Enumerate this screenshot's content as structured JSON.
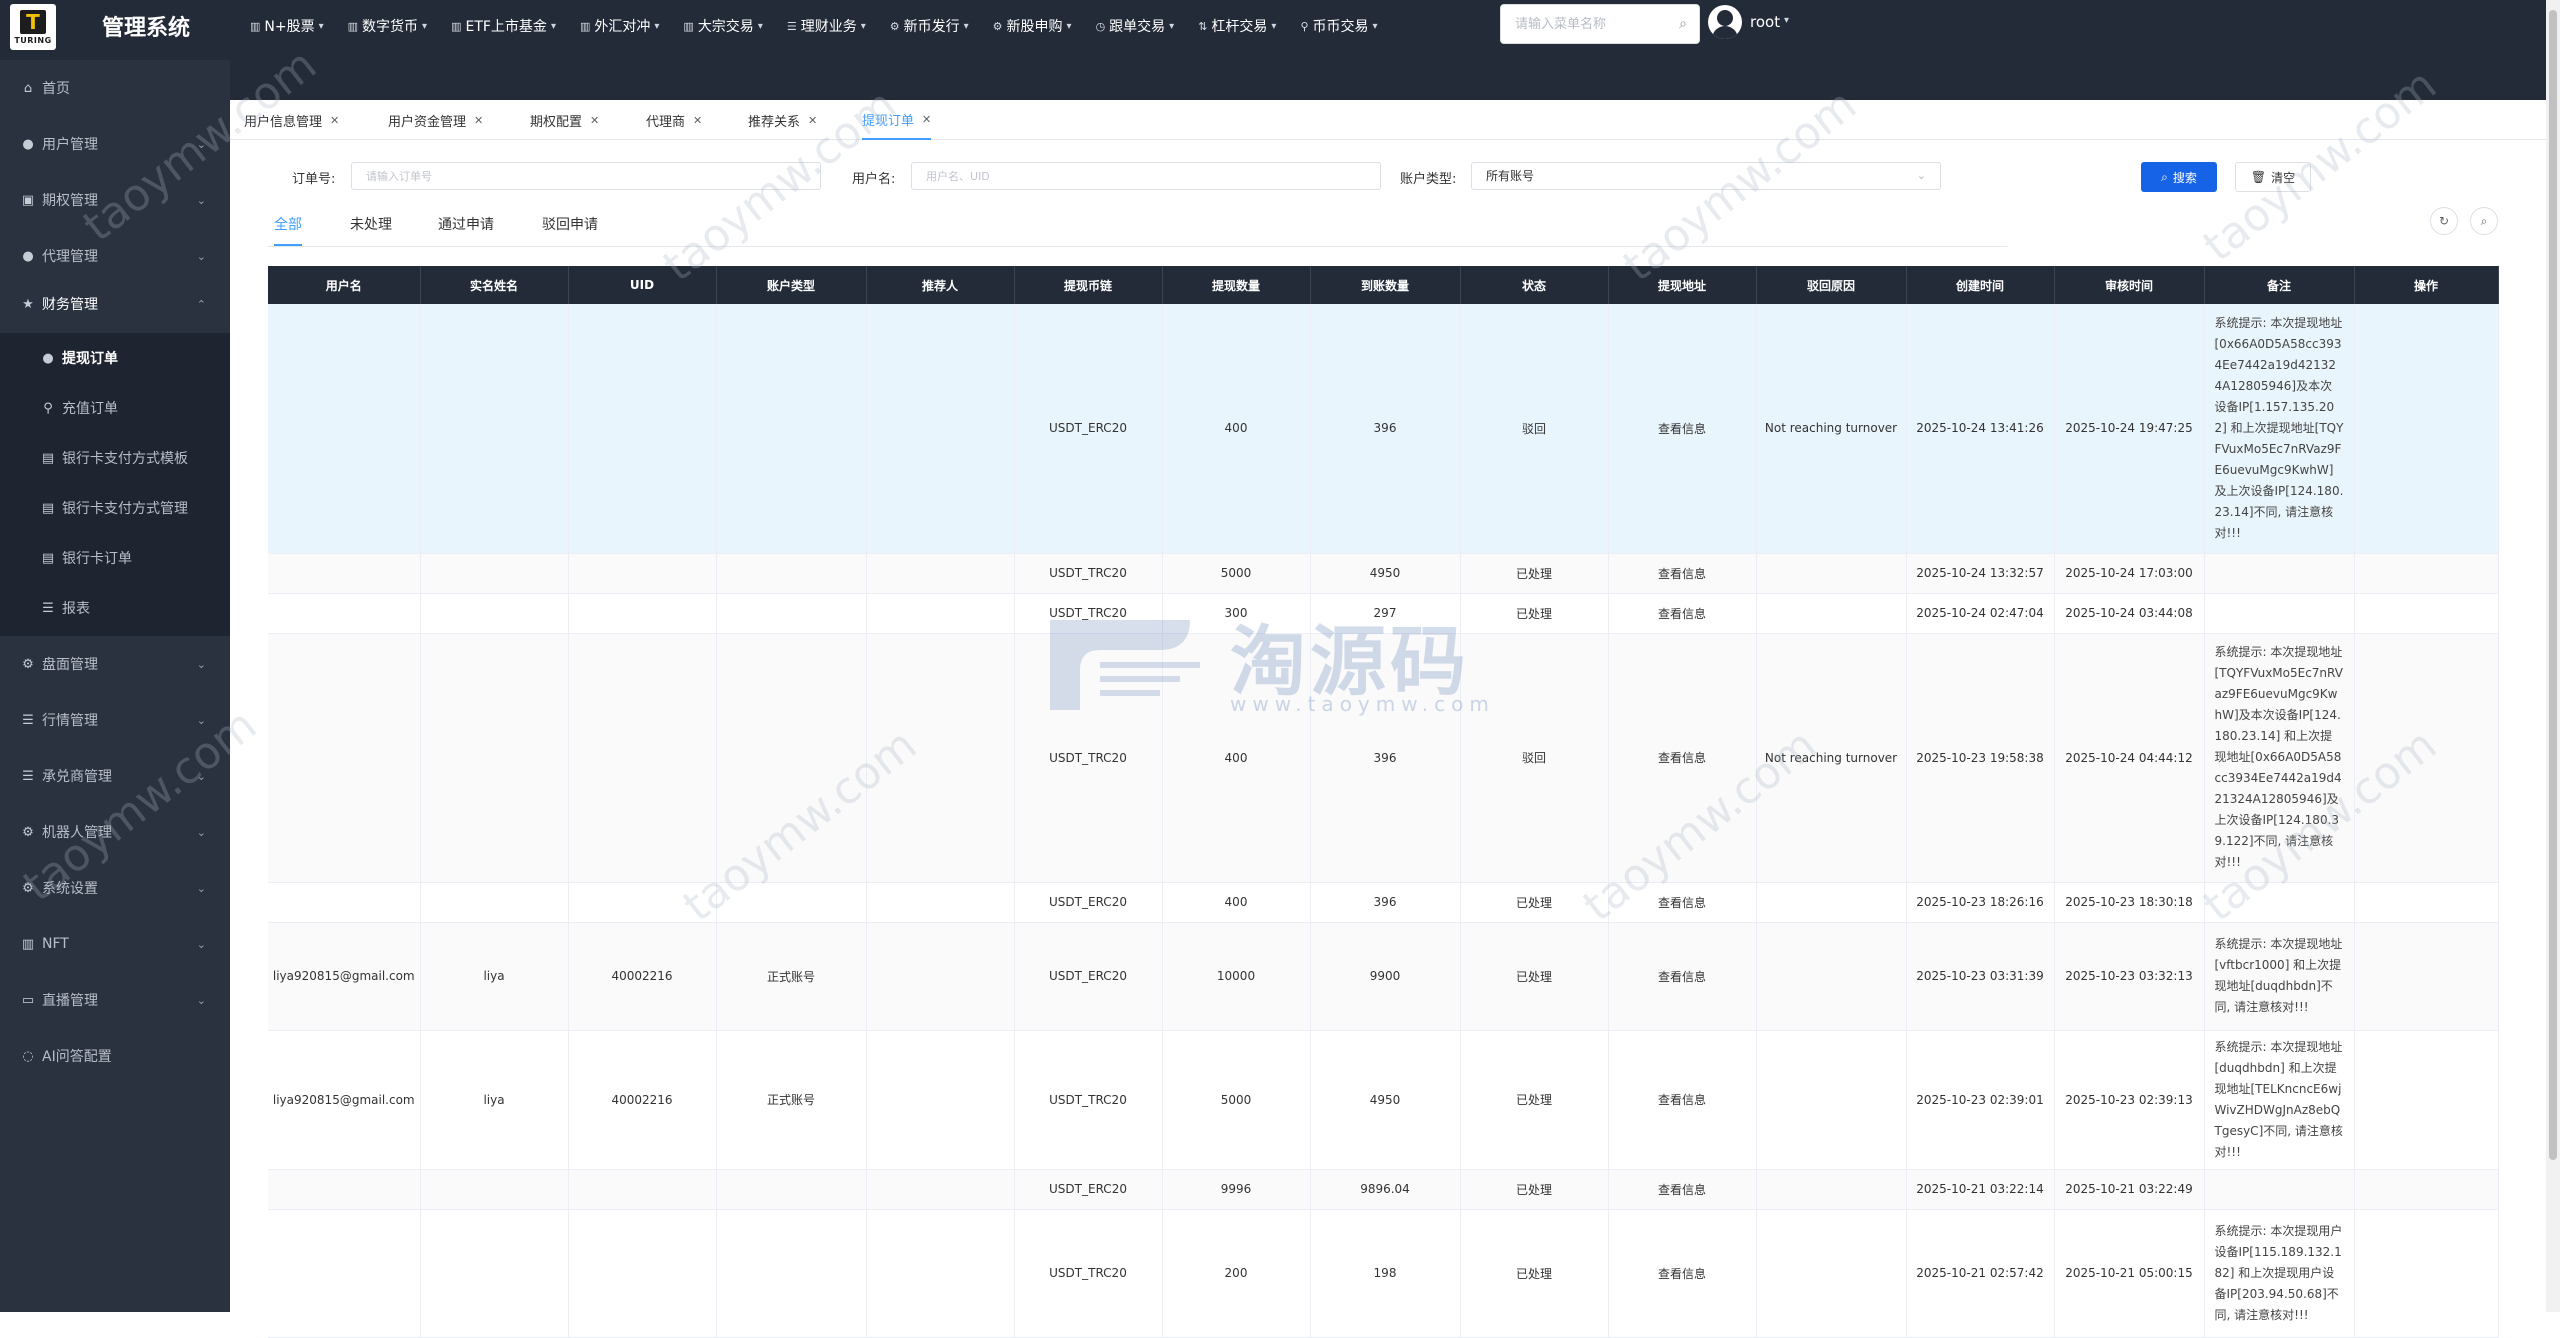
{
  "app": {
    "logo_text": "TURING",
    "title": "管理系统"
  },
  "top_nav": [
    {
      "label": "N+股票",
      "icon": "chart-icon"
    },
    {
      "label": "数字货币",
      "icon": "chart-icon"
    },
    {
      "label": "ETF上市基金",
      "icon": "chart-icon"
    },
    {
      "label": "外汇对冲",
      "icon": "chart-icon"
    },
    {
      "label": "大宗交易",
      "icon": "chart-icon"
    },
    {
      "label": "理财业务",
      "icon": "list-icon"
    },
    {
      "label": "新币发行",
      "icon": "gear-icon"
    },
    {
      "label": "新股申购",
      "icon": "gear-icon"
    },
    {
      "label": "跟单交易",
      "icon": "clock-icon"
    },
    {
      "label": "杠杆交易",
      "icon": "arrows-icon"
    },
    {
      "label": "币币交易",
      "icon": "pin-icon"
    }
  ],
  "top_search": {
    "placeholder": "请输入菜单名称"
  },
  "user": {
    "name": "root"
  },
  "sidebar": {
    "items": [
      {
        "label": "首页",
        "icon": "home-icon"
      },
      {
        "label": "用户管理",
        "icon": "user-icon"
      },
      {
        "label": "期权管理",
        "icon": "option-icon"
      },
      {
        "label": "代理管理",
        "icon": "agent-icon"
      },
      {
        "label": "财务管理",
        "icon": "star-icon"
      },
      {
        "label": "提现订单",
        "icon": "user-icon"
      },
      {
        "label": "充值订单",
        "icon": "pin-icon"
      },
      {
        "label": "银行卡支付方式模板",
        "icon": "doc-icon"
      },
      {
        "label": "银行卡支付方式管理",
        "icon": "doc-icon"
      },
      {
        "label": "银行卡订单",
        "icon": "doc-icon"
      },
      {
        "label": "报表",
        "icon": "list-icon"
      },
      {
        "label": "盘面管理",
        "icon": "gear-icon"
      },
      {
        "label": "行情管理",
        "icon": "list-icon"
      },
      {
        "label": "承兑商管理",
        "icon": "list-icon"
      },
      {
        "label": "机器人管理",
        "icon": "gear-icon"
      },
      {
        "label": "系统设置",
        "icon": "gear-icon"
      },
      {
        "label": "NFT",
        "icon": "chart-icon"
      },
      {
        "label": "直播管理",
        "icon": "video-icon"
      },
      {
        "label": "AI问答配置",
        "icon": "ai-icon"
      }
    ]
  },
  "page_tabs": [
    {
      "label": "用户信息管理"
    },
    {
      "label": "用户资金管理"
    },
    {
      "label": "期权配置"
    },
    {
      "label": "代理商"
    },
    {
      "label": "推荐关系"
    },
    {
      "label": "提现订单"
    }
  ],
  "filters": {
    "order_label": "订单号:",
    "order_placeholder": "请输入订单号",
    "user_label": "用户名:",
    "user_placeholder": "用户名、UID",
    "account_label": "账户类型:",
    "account_value": "所有账号",
    "search_btn": "搜索",
    "clear_btn": "清空"
  },
  "status_tabs": [
    {
      "label": "全部"
    },
    {
      "label": "未处理"
    },
    {
      "label": "通过申请"
    },
    {
      "label": "驳回申请"
    }
  ],
  "table": {
    "headers": [
      "用户名",
      "实名姓名",
      "UID",
      "账户类型",
      "推荐人",
      "提现币链",
      "提现数量",
      "到账数量",
      "状态",
      "提现地址",
      "驳回原因",
      "创建时间",
      "审核时间",
      "备注",
      "操作"
    ],
    "rows": [
      {
        "username": "",
        "realname": "",
        "uid": "",
        "acct": "",
        "referrer": "",
        "chain": "USDT_ERC20",
        "amount": "400",
        "received": "396",
        "status": "驳回",
        "addr": "查看信息",
        "reason": "Not reaching turnover",
        "created": "2025-10-24 13:41:26",
        "reviewed": "2025-10-24 19:47:25",
        "remark": "系统提示: 本次提现地址[0x66A0D5A58cc3934Ee7442a19d421324A12805946]及本次设备IP[1.157.135.202] 和上次提现地址[TQYFVuxMo5Ec7nRVaz9FE6uevuMgc9KwhW]及上次设备IP[124.180.23.14]不同, 请注意核对!!!"
      },
      {
        "username": "",
        "realname": "",
        "uid": "",
        "acct": "",
        "referrer": "",
        "chain": "USDT_TRC20",
        "amount": "5000",
        "received": "4950",
        "status": "已处理",
        "addr": "查看信息",
        "reason": "",
        "created": "2025-10-24 13:32:57",
        "reviewed": "2025-10-24 17:03:00",
        "remark": ""
      },
      {
        "username": "",
        "realname": "",
        "uid": "",
        "acct": "",
        "referrer": "",
        "chain": "USDT_TRC20",
        "amount": "300",
        "received": "297",
        "status": "已处理",
        "addr": "查看信息",
        "reason": "",
        "created": "2025-10-24 02:47:04",
        "reviewed": "2025-10-24 03:44:08",
        "remark": ""
      },
      {
        "username": "",
        "realname": "",
        "uid": "",
        "acct": "",
        "referrer": "",
        "chain": "USDT_TRC20",
        "amount": "400",
        "received": "396",
        "status": "驳回",
        "addr": "查看信息",
        "reason": "Not reaching turnover",
        "created": "2025-10-23 19:58:38",
        "reviewed": "2025-10-24 04:44:12",
        "remark": "系统提示: 本次提现地址[TQYFVuxMo5Ec7nRVaz9FE6uevuMgc9KwhW]及本次设备IP[124.180.23.14] 和上次提现地址[0x66A0D5A58cc3934Ee7442a19d421324A12805946]及上次设备IP[124.180.39.122]不同, 请注意核对!!!"
      },
      {
        "username": "",
        "realname": "",
        "uid": "",
        "acct": "",
        "referrer": "",
        "chain": "USDT_ERC20",
        "amount": "400",
        "received": "396",
        "status": "已处理",
        "addr": "查看信息",
        "reason": "",
        "created": "2025-10-23 18:26:16",
        "reviewed": "2025-10-23 18:30:18",
        "remark": ""
      },
      {
        "username": "liya920815@gmail.com",
        "realname": "liya",
        "uid": "40002216",
        "acct": "正式账号",
        "referrer": "",
        "chain": "USDT_ERC20",
        "amount": "10000",
        "received": "9900",
        "status": "已处理",
        "addr": "查看信息",
        "reason": "",
        "created": "2025-10-23 03:31:39",
        "reviewed": "2025-10-23 03:32:13",
        "remark": "系统提示: 本次提现地址[vftbcr1000] 和上次提现地址[duqdhbdn]不同, 请注意核对!!!"
      },
      {
        "username": "liya920815@gmail.com",
        "realname": "liya",
        "uid": "40002216",
        "acct": "正式账号",
        "referrer": "",
        "chain": "USDT_TRC20",
        "amount": "5000",
        "received": "4950",
        "status": "已处理",
        "addr": "查看信息",
        "reason": "",
        "created": "2025-10-23 02:39:01",
        "reviewed": "2025-10-23 02:39:13",
        "remark": "系统提示: 本次提现地址[duqdhbdn] 和上次提现地址[TELKncncE6wjWivZHDWgJnAz8ebQTgesyC]不同, 请注意核对!!!"
      },
      {
        "username": "",
        "realname": "",
        "uid": "",
        "acct": "",
        "referrer": "",
        "chain": "USDT_ERC20",
        "amount": "9996",
        "received": "9896.04",
        "status": "已处理",
        "addr": "查看信息",
        "reason": "",
        "created": "2025-10-21 03:22:14",
        "reviewed": "2025-10-21 03:22:49",
        "remark": ""
      },
      {
        "username": "",
        "realname": "",
        "uid": "",
        "acct": "",
        "referrer": "",
        "chain": "USDT_TRC20",
        "amount": "200",
        "received": "198",
        "status": "已处理",
        "addr": "查看信息",
        "reason": "",
        "created": "2025-10-21 02:57:42",
        "reviewed": "2025-10-21 05:00:15",
        "remark": "系统提示: 本次提现用户设备IP[115.189.132.182] 和上次提现用户设备IP[203.94.50.68]不同, 请注意核对!!!"
      }
    ]
  },
  "watermark": {
    "text": "taoymw.com",
    "center_big": "淘源码",
    "center_small": "www.taoymw.com"
  },
  "colors": {
    "topbar": "#232b38",
    "sidebar": "#2b323f",
    "primary": "#1763e8",
    "accent": "#409eff",
    "red": "#e02424",
    "green": "#3aa93a"
  }
}
